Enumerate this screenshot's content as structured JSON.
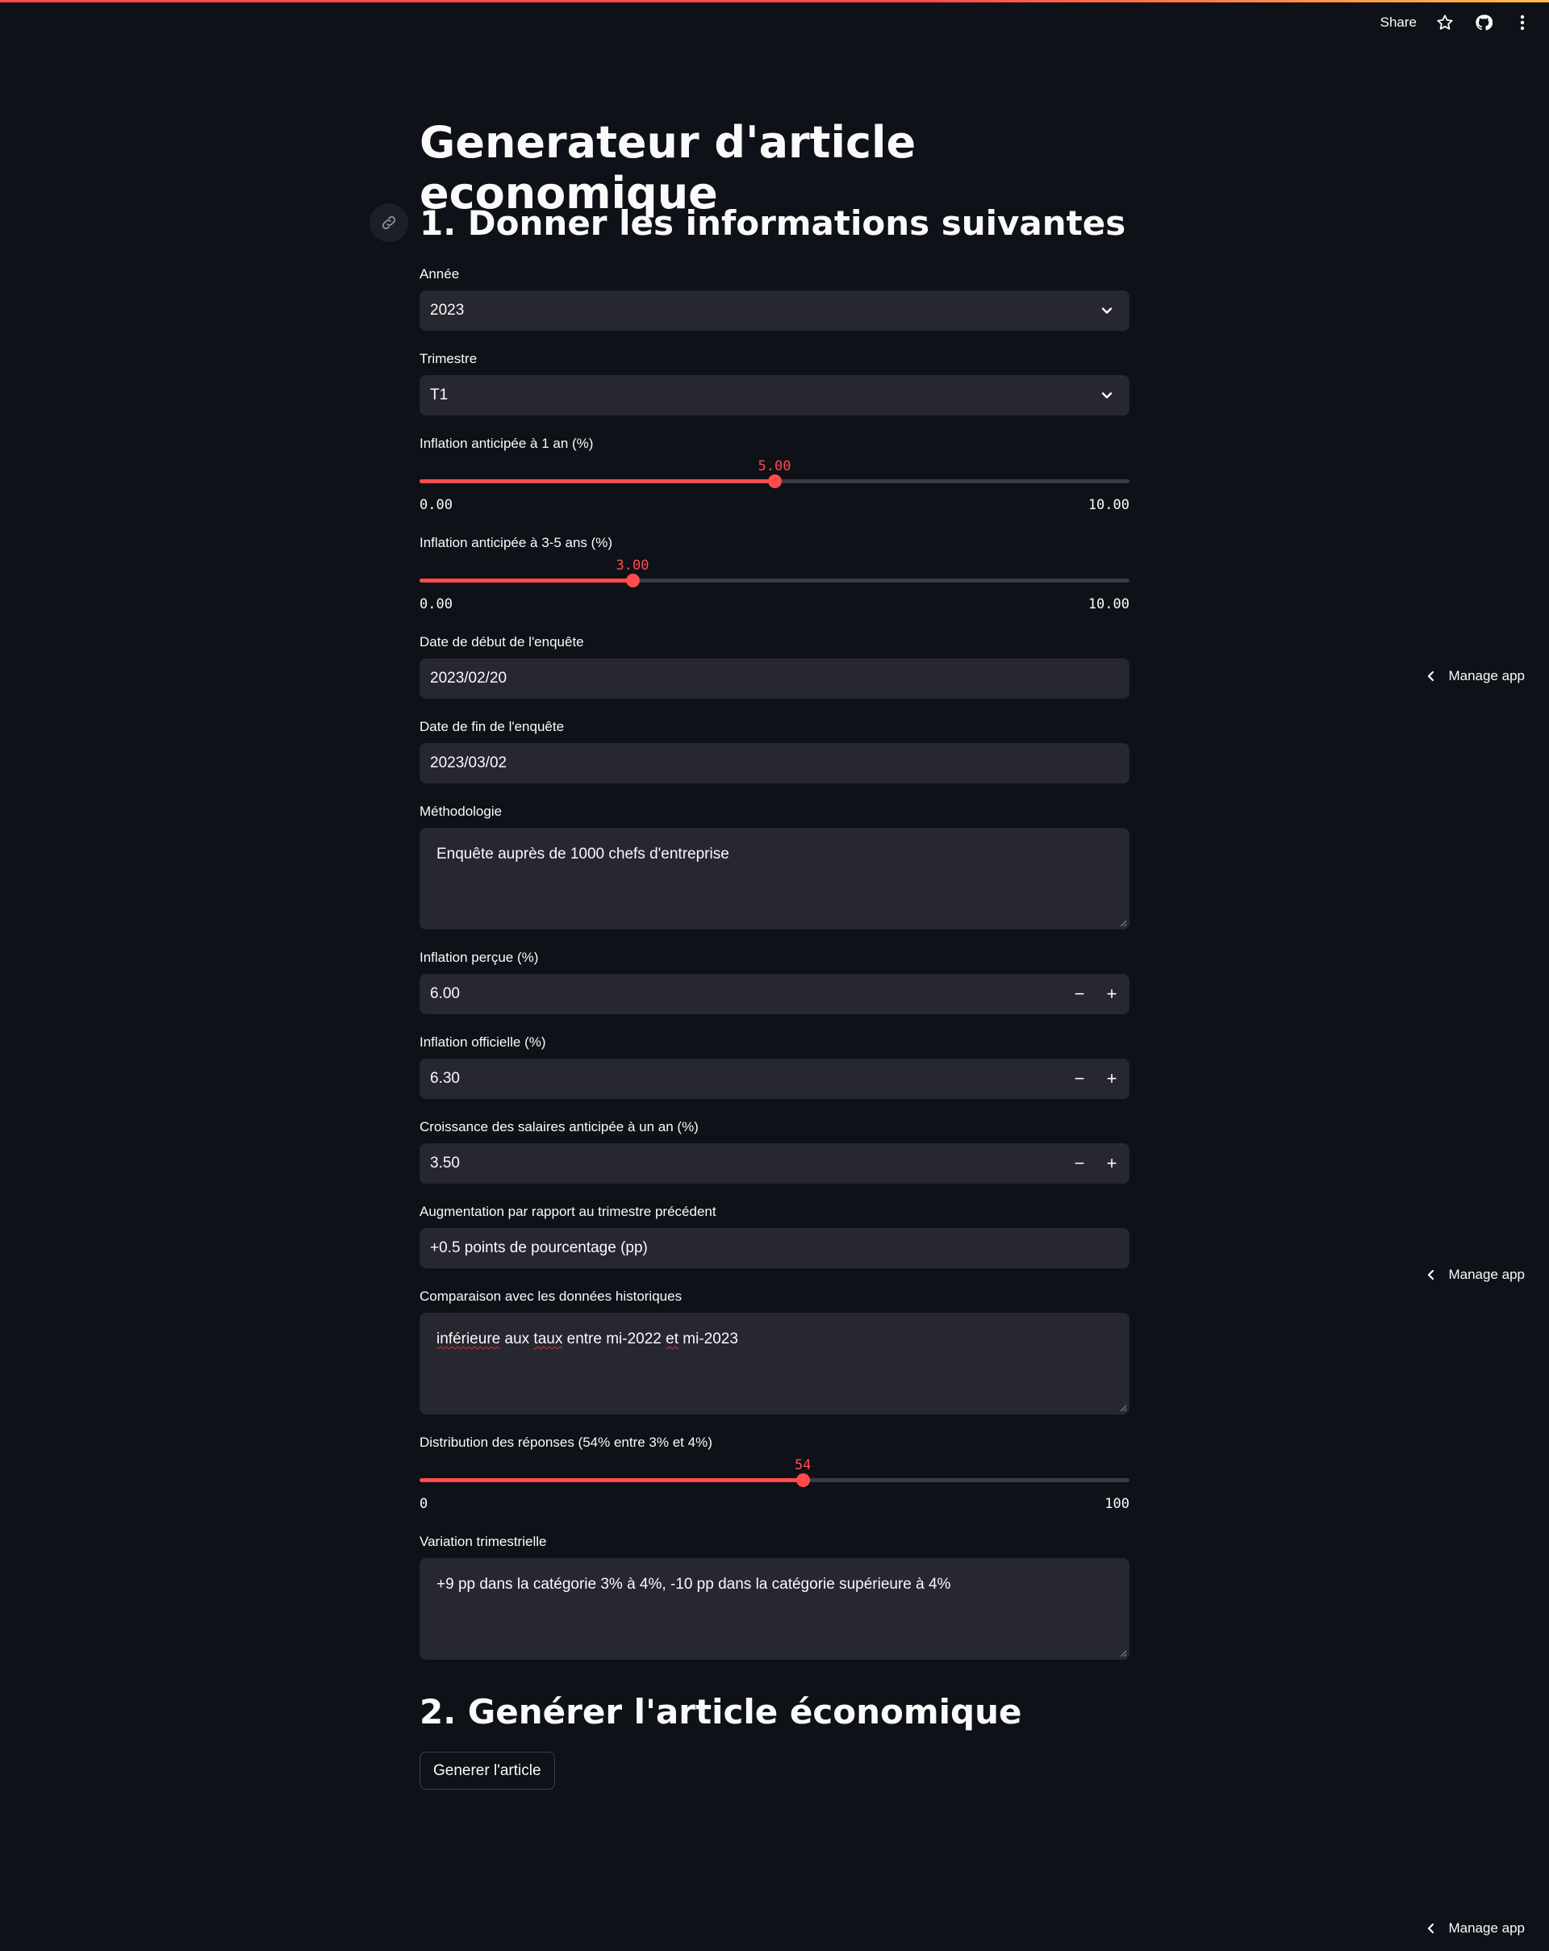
{
  "header": {
    "share_label": "Share",
    "icons": [
      "star-icon",
      "github-icon",
      "kebab-menu-icon"
    ]
  },
  "title": "Generateur d'article economique",
  "section1": {
    "heading": "1. Donner les informations suivantes"
  },
  "fields": {
    "annee": {
      "label": "Année",
      "value": "2023"
    },
    "trimestre": {
      "label": "Trimestre",
      "value": "T1"
    },
    "inflation_1an": {
      "label": "Inflation anticipée à 1 an (%)",
      "value": 5.0,
      "value_text": "5.00",
      "min_text": "0.00",
      "max_text": "10.00",
      "min": 0,
      "max": 10
    },
    "inflation_3_5ans": {
      "label": "Inflation anticipée à 3-5 ans (%)",
      "value": 3.0,
      "value_text": "3.00",
      "min_text": "0.00",
      "max_text": "10.00",
      "min": 0,
      "max": 10
    },
    "date_debut": {
      "label": "Date de début de l'enquête",
      "value": "2023/02/20"
    },
    "date_fin": {
      "label": "Date de fin de l'enquête",
      "value": "2023/03/02"
    },
    "methodologie": {
      "label": "Méthodologie",
      "value": "Enquête auprès de 1000 chefs d'entreprise"
    },
    "inflation_percue": {
      "label": "Inflation perçue (%)",
      "value": "6.00"
    },
    "inflation_officielle": {
      "label": "Inflation officielle (%)",
      "value": "6.30"
    },
    "croissance_salaires": {
      "label": "Croissance des salaires anticipée à un an (%)",
      "value": "3.50"
    },
    "augmentation": {
      "label": "Augmentation par rapport au trimestre précédent",
      "value": "+0.5 points de pourcentage (pp)"
    },
    "comparaison": {
      "label": "Comparaison avec les données historiques",
      "value_parts": [
        "inférieure",
        " aux ",
        "taux",
        " entre mi-2022 ",
        "et",
        " mi-2023"
      ]
    },
    "distribution": {
      "label": "Distribution des réponses (54% entre 3% et 4%)",
      "value": 54,
      "value_text": "54",
      "min_text": "0",
      "max_text": "100",
      "min": 0,
      "max": 100
    },
    "variation": {
      "label": "Variation trimestrielle",
      "value": "+9 pp dans la catégorie 3% à 4%, -10 pp dans la catégorie supérieure à 4%"
    }
  },
  "number_controls": {
    "minus": "−",
    "plus": "+"
  },
  "section2": {
    "heading": "2. Genérer l'article économique",
    "button_label": "Generer l'article"
  },
  "manage_app_label": "Manage app"
}
